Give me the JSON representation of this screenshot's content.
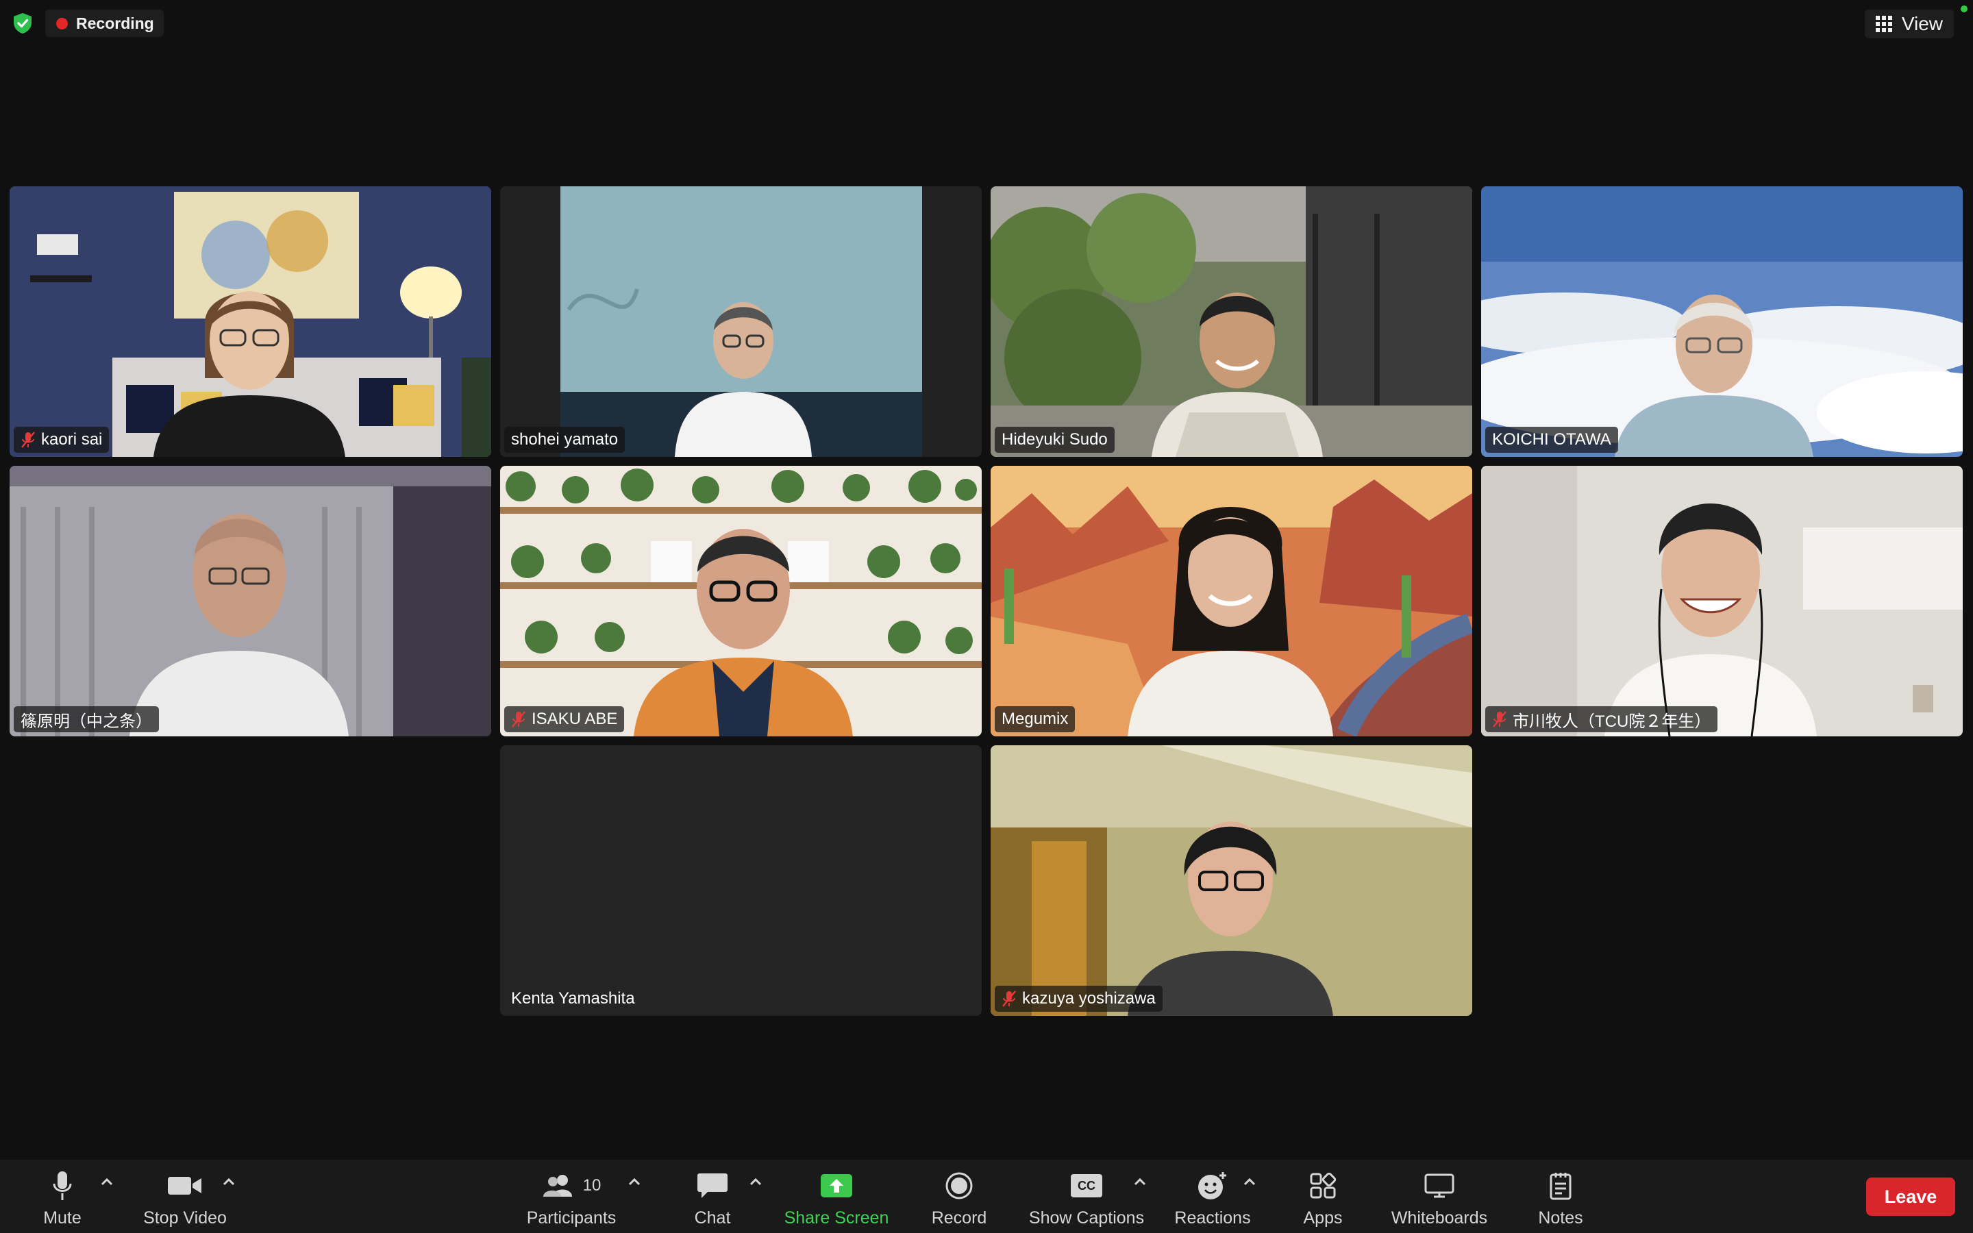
{
  "top_bar": {
    "recording_label": "Recording",
    "view_label": "View"
  },
  "participants": [
    {
      "name": "kaori sai",
      "muted": true
    },
    {
      "name": "shohei yamato",
      "muted": false
    },
    {
      "name": "Hideyuki Sudo",
      "muted": false
    },
    {
      "name": "KOICHI OTAWA",
      "muted": false
    },
    {
      "name": "篠原明（中之条）",
      "muted": false
    },
    {
      "name": "ISAKU ABE",
      "muted": true
    },
    {
      "name": "Megumix",
      "muted": false,
      "active_speaker": true
    },
    {
      "name": "市川牧人（TCU院２年生）",
      "muted": true
    },
    {
      "name": "Kenta Yamashita",
      "muted": false,
      "video_off": true
    },
    {
      "name": "kazuya yoshizawa",
      "muted": true
    }
  ],
  "toolbar": {
    "mute_label": "Mute",
    "stop_video_label": "Stop Video",
    "participants_label": "Participants",
    "participants_count": "10",
    "chat_label": "Chat",
    "share_screen_label": "Share Screen",
    "record_label": "Record",
    "show_captions_label": "Show Captions",
    "captions_icon_text": "CC",
    "reactions_label": "Reactions",
    "apps_label": "Apps",
    "whiteboards_label": "Whiteboards",
    "notes_label": "Notes",
    "leave_label": "Leave"
  },
  "colors": {
    "background": "#101010",
    "toolbar": "#1a1a1a",
    "active_speaker_border": "#3ad04a",
    "share_green": "#41d157",
    "leave_red": "#d8262c",
    "recording_dot": "#e02828"
  }
}
